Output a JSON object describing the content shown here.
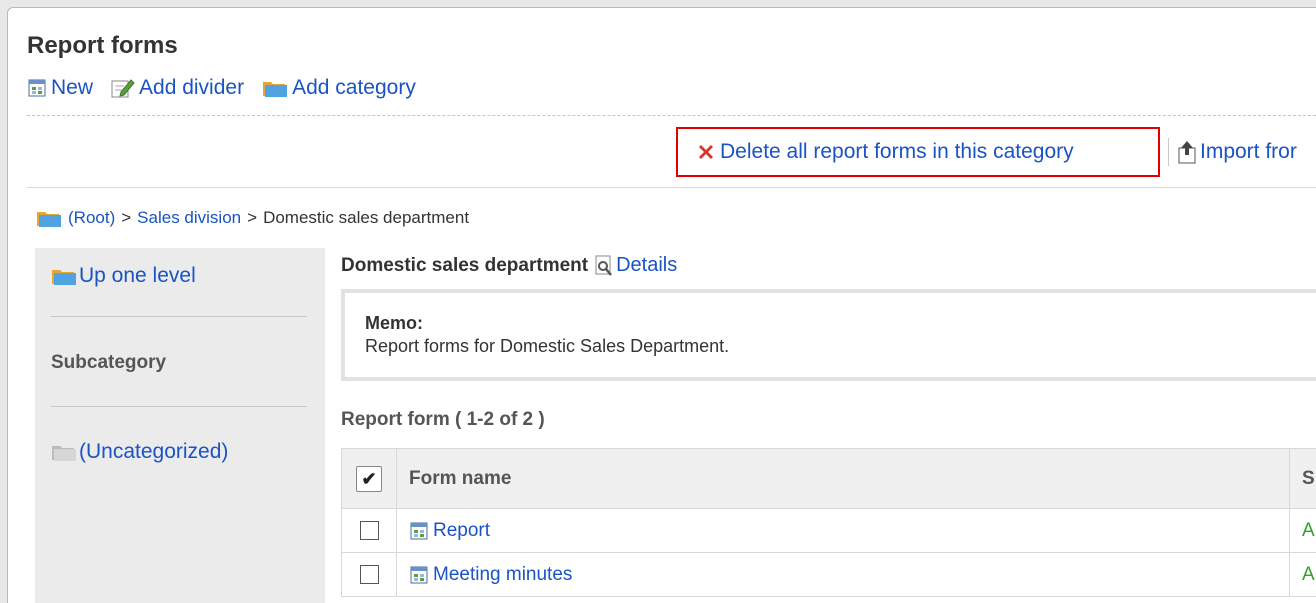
{
  "page": {
    "title": "Report forms"
  },
  "toolbar": {
    "new_label": "New",
    "add_divider_label": "Add divider",
    "add_category_label": "Add category"
  },
  "actions": {
    "delete_all_label": "Delete all report forms in this category",
    "import_label": "Import fror"
  },
  "breadcrumb": {
    "root": "(Root)",
    "sep1": ">",
    "level1": "Sales division",
    "sep2": ">",
    "current": "Domestic sales department"
  },
  "sidebar": {
    "up_label": "Up one level",
    "subcategory_heading": "Subcategory",
    "uncategorized_label": "(Uncategorized)"
  },
  "category": {
    "name": "Domestic sales department",
    "details_label": "Details",
    "memo_label": "Memo:",
    "memo_text": "Report forms for Domestic Sales Department."
  },
  "list": {
    "title": "Report form ( 1-2 of 2 )",
    "select_all_glyph": "✔",
    "columns": {
      "name": "Form name",
      "status": "S"
    },
    "rows": [
      {
        "name": "Report",
        "status": "A"
      },
      {
        "name": "Meeting minutes",
        "status": "A"
      }
    ]
  },
  "colors": {
    "link": "#1a53c6",
    "highlight": "#e00000",
    "status": "#33a02c",
    "delete_icon": "#d9342b"
  },
  "icons": [
    "form-icon",
    "edit-icon",
    "folder-icon",
    "delete-icon",
    "import-icon",
    "folder-up-icon",
    "folder-gray-icon",
    "details-icon"
  ]
}
